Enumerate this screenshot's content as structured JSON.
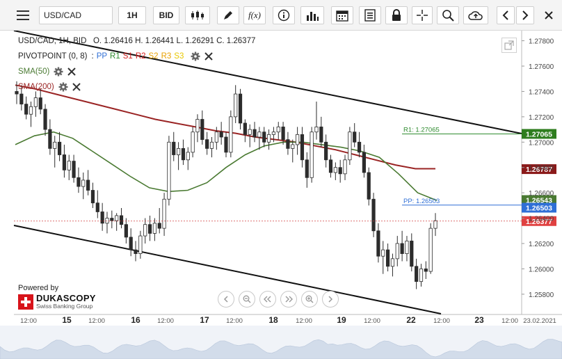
{
  "toolbar": {
    "symbol": "USD/CAD",
    "timeframe": "1H",
    "price_type": "BID",
    "function_label": "f(x)"
  },
  "legend": {
    "ohlc_line": "USD/CAD, 1H, BID   O. 1.26416 H. 1.26441 L. 1.26291 C. 1.26377",
    "pivot_name": "PIVOTPOINT (0, 8)",
    "pivot_sep": ":",
    "pivot_items": [
      {
        "label": "PP",
        "color": "#2f6fd6"
      },
      {
        "label": "R1",
        "color": "#2e8b2e"
      },
      {
        "label": "S1",
        "color": "#d62020"
      },
      {
        "label": "R2",
        "color": "#d62020"
      },
      {
        "label": "S2",
        "color": "#e8a000"
      },
      {
        "label": "R3",
        "color": "#e8a000"
      },
      {
        "label": "S3",
        "color": "#e8c800"
      }
    ],
    "sma50": {
      "label": "SMA(50)",
      "color": "#4a7a32"
    },
    "sma200": {
      "label": "SMA(200)",
      "color": "#9a2424"
    }
  },
  "branding": {
    "powered_by": "Powered by",
    "brand": "DUKASCOPY",
    "tagline": "Swiss Banking Group"
  },
  "chart_data": {
    "type": "candlestick",
    "symbol": "USD/CAD",
    "timeframe": "1H",
    "y_range": [
      1.2565,
      1.279
    ],
    "y_ticks": [
      "1.27800",
      "1.27600",
      "1.27400",
      "1.27200",
      "1.27000",
      "1.26800",
      "1.26600",
      "1.26400",
      "1.26200",
      "1.26000",
      "1.25800"
    ],
    "x_ticks": [
      "12:00",
      "15",
      "12:00",
      "16",
      "12:00",
      "17",
      "12:00",
      "18",
      "12:00",
      "19",
      "12:00",
      "22",
      "12:00",
      "23",
      "12:00",
      "23.02.2021"
    ],
    "price_labels": [
      {
        "text": "1.27065",
        "value": 1.27065,
        "color": "#2e7d1e"
      },
      {
        "text": "1.26787",
        "value": 1.26787,
        "color": "#8b1a1a"
      },
      {
        "text": "1.26543",
        "value": 1.26543,
        "color": "#4a7a32"
      },
      {
        "text": "1.26503",
        "value": 1.26503,
        "color": "#2f6fd6"
      },
      {
        "text": "1.26377",
        "value": 1.26377,
        "color": "#e04040"
      }
    ],
    "pivot_lines": [
      {
        "label": "R1: 1.27065",
        "value": 1.27065,
        "color": "#2e8b2e"
      },
      {
        "label": "PP: 1.26503",
        "value": 1.26503,
        "color": "#2f6fd6"
      }
    ],
    "current_price": 1.26377,
    "open": 1.26416,
    "high": 1.26441,
    "low": 1.26291,
    "close": 1.26377,
    "candles": [
      [
        1.274,
        1.2748,
        1.273,
        1.2738
      ],
      [
        1.2738,
        1.2745,
        1.2725,
        1.273
      ],
      [
        1.273,
        1.2736,
        1.2718,
        1.2722
      ],
      [
        1.2722,
        1.2732,
        1.2712,
        1.2728
      ],
      [
        1.2728,
        1.274,
        1.272,
        1.2735
      ],
      [
        1.2735,
        1.2742,
        1.2722,
        1.2726
      ],
      [
        1.2726,
        1.273,
        1.2705,
        1.271
      ],
      [
        1.271,
        1.2718,
        1.269,
        1.2695
      ],
      [
        1.2695,
        1.2705,
        1.268,
        1.27
      ],
      [
        1.27,
        1.2708,
        1.2685,
        1.269
      ],
      [
        1.269,
        1.2698,
        1.2672,
        1.2678
      ],
      [
        1.2678,
        1.269,
        1.267,
        1.2685
      ],
      [
        1.2685,
        1.269,
        1.2668,
        1.2672
      ],
      [
        1.2672,
        1.268,
        1.266,
        1.2665
      ],
      [
        1.2665,
        1.2676,
        1.2655,
        1.267
      ],
      [
        1.267,
        1.2678,
        1.2658,
        1.2662
      ],
      [
        1.2662,
        1.2668,
        1.2648,
        1.2652
      ],
      [
        1.2652,
        1.2662,
        1.264,
        1.2645
      ],
      [
        1.2645,
        1.2652,
        1.263,
        1.2636
      ],
      [
        1.2636,
        1.2645,
        1.2628,
        1.264
      ],
      [
        1.264,
        1.2646,
        1.2632,
        1.2638
      ],
      [
        1.2638,
        1.2644,
        1.263,
        1.2642
      ],
      [
        1.2642,
        1.2648,
        1.2632,
        1.2635
      ],
      [
        1.2635,
        1.264,
        1.262,
        1.2625
      ],
      [
        1.2625,
        1.2632,
        1.261,
        1.2615
      ],
      [
        1.2615,
        1.2622,
        1.2606,
        1.2612
      ],
      [
        1.2612,
        1.263,
        1.2608,
        1.2626
      ],
      [
        1.2626,
        1.264,
        1.262,
        1.2635
      ],
      [
        1.2635,
        1.2642,
        1.2622,
        1.2628
      ],
      [
        1.2628,
        1.264,
        1.2622,
        1.2636
      ],
      [
        1.2636,
        1.2648,
        1.2628,
        1.2632
      ],
      [
        1.2632,
        1.266,
        1.2626,
        1.2655
      ],
      [
        1.2655,
        1.2705,
        1.265,
        1.27
      ],
      [
        1.27,
        1.2708,
        1.2685,
        1.269
      ],
      [
        1.269,
        1.27,
        1.2678,
        1.2695
      ],
      [
        1.2695,
        1.2702,
        1.2682,
        1.2686
      ],
      [
        1.2686,
        1.2696,
        1.2678,
        1.2692
      ],
      [
        1.2692,
        1.2712,
        1.2688,
        1.2708
      ],
      [
        1.2708,
        1.2722,
        1.27,
        1.2718
      ],
      [
        1.2718,
        1.2725,
        1.2698,
        1.2702
      ],
      [
        1.2702,
        1.2708,
        1.269,
        1.2695
      ],
      [
        1.2695,
        1.2704,
        1.2688,
        1.27
      ],
      [
        1.27,
        1.2712,
        1.2694,
        1.2708
      ],
      [
        1.2708,
        1.2716,
        1.2698,
        1.2704
      ],
      [
        1.2704,
        1.2708,
        1.2688,
        1.2692
      ],
      [
        1.2692,
        1.2725,
        1.2688,
        1.272
      ],
      [
        1.272,
        1.2745,
        1.2715,
        1.2738
      ],
      [
        1.2738,
        1.2742,
        1.271,
        1.2715
      ],
      [
        1.2715,
        1.2718,
        1.27,
        1.2706
      ],
      [
        1.2706,
        1.2714,
        1.2696,
        1.271
      ],
      [
        1.271,
        1.2716,
        1.27,
        1.2704
      ],
      [
        1.2704,
        1.2712,
        1.2694,
        1.2708
      ],
      [
        1.2708,
        1.2712,
        1.2696,
        1.27
      ],
      [
        1.27,
        1.271,
        1.2694,
        1.2706
      ],
      [
        1.2706,
        1.2712,
        1.27,
        1.2708
      ],
      [
        1.2708,
        1.2716,
        1.2702,
        1.2712
      ],
      [
        1.2712,
        1.2716,
        1.2698,
        1.2702
      ],
      [
        1.2702,
        1.2708,
        1.269,
        1.2695
      ],
      [
        1.2695,
        1.2702,
        1.2684,
        1.2698
      ],
      [
        1.2698,
        1.2712,
        1.269,
        1.2706
      ],
      [
        1.2706,
        1.2712,
        1.268,
        1.2686
      ],
      [
        1.2686,
        1.2692,
        1.2664,
        1.2672
      ],
      [
        1.2672,
        1.2712,
        1.2668,
        1.2708
      ],
      [
        1.2708,
        1.2732,
        1.2702,
        1.2712
      ],
      [
        1.2712,
        1.272,
        1.2696,
        1.27
      ],
      [
        1.27,
        1.2706,
        1.268,
        1.2686
      ],
      [
        1.2686,
        1.269,
        1.2672,
        1.2676
      ],
      [
        1.2676,
        1.2684,
        1.267,
        1.268
      ],
      [
        1.268,
        1.2686,
        1.2668,
        1.2675
      ],
      [
        1.2675,
        1.269,
        1.267,
        1.2686
      ],
      [
        1.2686,
        1.2712,
        1.2682,
        1.2708
      ],
      [
        1.2708,
        1.2715,
        1.2696,
        1.27
      ],
      [
        1.27,
        1.2708,
        1.2688,
        1.2692
      ],
      [
        1.2692,
        1.2698,
        1.2672,
        1.2676
      ],
      [
        1.2676,
        1.268,
        1.265,
        1.2655
      ],
      [
        1.2655,
        1.266,
        1.2625,
        1.263
      ],
      [
        1.263,
        1.2636,
        1.2605,
        1.261
      ],
      [
        1.261,
        1.2622,
        1.2596,
        1.2615
      ],
      [
        1.2615,
        1.262,
        1.2598,
        1.2602
      ],
      [
        1.2602,
        1.2612,
        1.2594,
        1.2608
      ],
      [
        1.2608,
        1.2626,
        1.2602,
        1.262
      ],
      [
        1.262,
        1.263,
        1.2606,
        1.2612
      ],
      [
        1.2612,
        1.2626,
        1.2606,
        1.2622
      ],
      [
        1.2622,
        1.2628,
        1.2598,
        1.2602
      ],
      [
        1.2602,
        1.2608,
        1.2584,
        1.259
      ],
      [
        1.259,
        1.2604,
        1.2586,
        1.26
      ],
      [
        1.26,
        1.2606,
        1.2592,
        1.2598
      ],
      [
        1.2598,
        1.2636,
        1.2596,
        1.2632
      ],
      [
        1.2632,
        1.2644,
        1.2626,
        1.2638
      ]
    ],
    "sma50": [
      1.2698,
      1.2705,
      1.2708,
      1.2703,
      1.2693,
      1.2683,
      1.2673,
      1.2664,
      1.2661,
      1.2662,
      1.2668,
      1.268,
      1.269,
      1.2697,
      1.27,
      1.27,
      1.2698,
      1.2696,
      1.2693,
      1.2688,
      1.2675,
      1.266,
      1.2654
    ],
    "sma200": [
      1.2745,
      1.2742,
      1.2738,
      1.2734,
      1.273,
      1.2726,
      1.2722,
      1.2718,
      1.2715,
      1.2712,
      1.2709,
      1.2707,
      1.2704,
      1.2702,
      1.27,
      1.2697,
      1.2694,
      1.269,
      1.2686,
      1.2682,
      1.2679,
      1.2679
    ],
    "trend_upper": [
      [
        0,
        1.2782
      ],
      [
        1,
        1.2705
      ]
    ],
    "trend_lower": [
      [
        0,
        1.2636
      ],
      [
        1,
        1.256
      ]
    ]
  }
}
